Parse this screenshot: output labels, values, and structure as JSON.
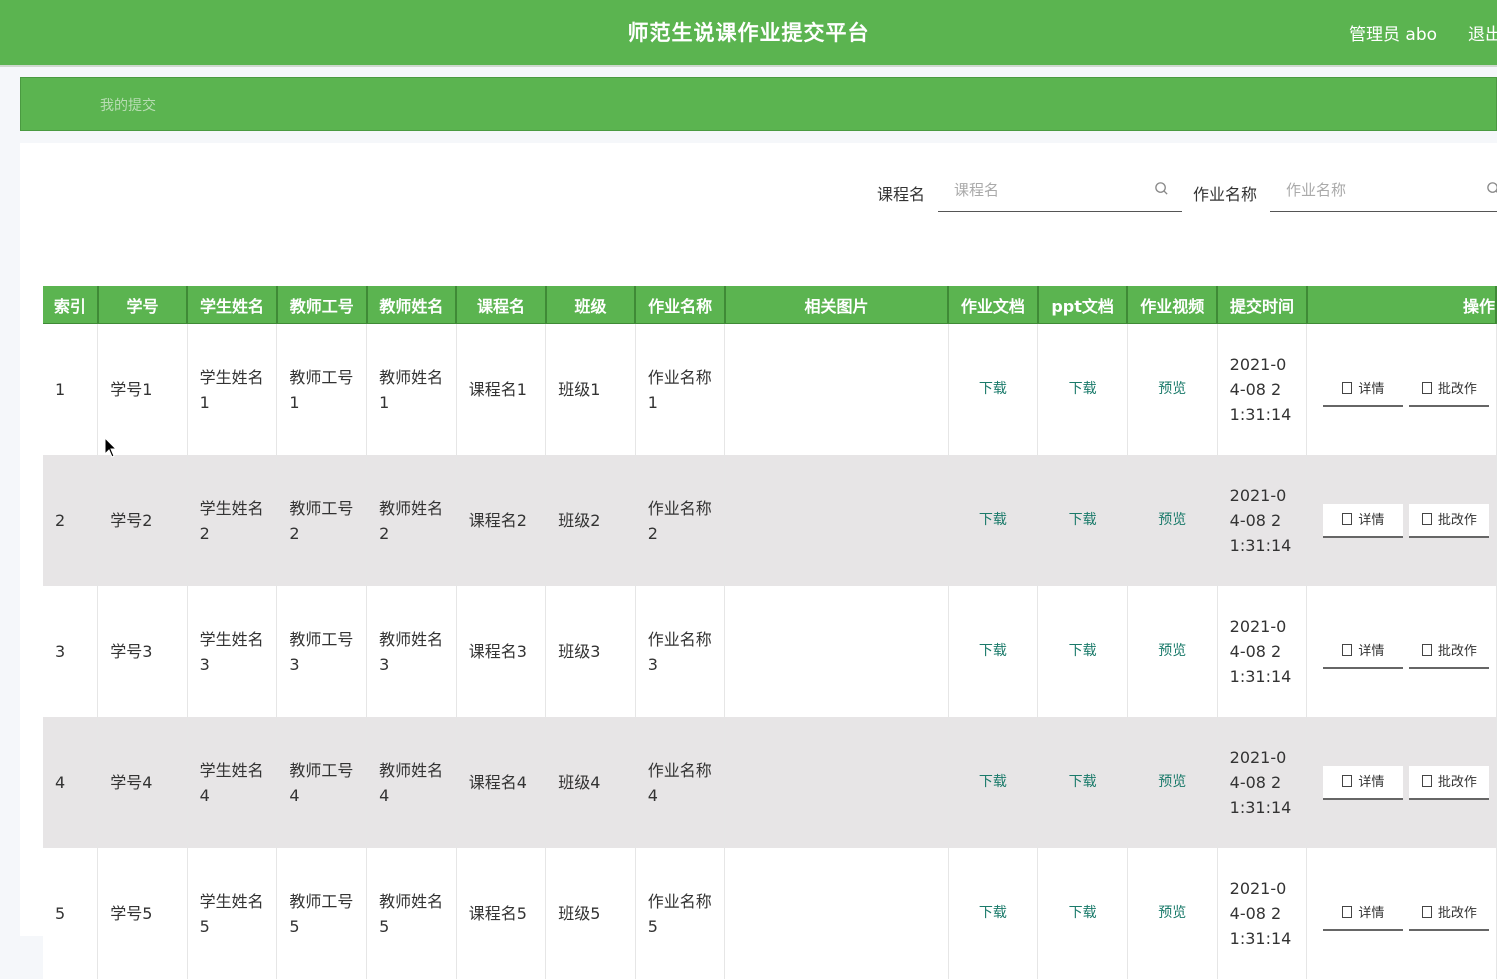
{
  "header": {
    "title": "师范生说课作业提交平台",
    "user": "管理员 abo",
    "logout": "退出"
  },
  "nav": {
    "items": [
      "我的提交"
    ]
  },
  "search": {
    "course_label": "课程名",
    "course_placeholder": "课程名",
    "homework_label": "作业名称",
    "homework_placeholder": "作业名称"
  },
  "table": {
    "columns": [
      "索引",
      "学号",
      "学生姓名",
      "教师工号",
      "教师姓名",
      "课程名",
      "班级",
      "作业名称",
      "相关图片",
      "作业文档",
      "ppt文档",
      "作业视频",
      "提交时间",
      "操作"
    ],
    "rows": [
      {
        "index": "1",
        "student_no": "学号1",
        "student_name": "学生姓名1",
        "teacher_no": "教师工号1",
        "teacher_name": "教师姓名1",
        "course": "课程名1",
        "class": "班级1",
        "homework": "作业名称1",
        "doc": "下载",
        "ppt": "下载",
        "video": "预览",
        "time": "2021-04-08 21:31:14",
        "detail": "详情",
        "grade": "批改作"
      },
      {
        "index": "2",
        "student_no": "学号2",
        "student_name": "学生姓名2",
        "teacher_no": "教师工号2",
        "teacher_name": "教师姓名2",
        "course": "课程名2",
        "class": "班级2",
        "homework": "作业名称2",
        "doc": "下载",
        "ppt": "下载",
        "video": "预览",
        "time": "2021-04-08 21:31:14",
        "detail": "详情",
        "grade": "批改作"
      },
      {
        "index": "3",
        "student_no": "学号3",
        "student_name": "学生姓名3",
        "teacher_no": "教师工号3",
        "teacher_name": "教师姓名3",
        "course": "课程名3",
        "class": "班级3",
        "homework": "作业名称3",
        "doc": "下载",
        "ppt": "下载",
        "video": "预览",
        "time": "2021-04-08 21:31:14",
        "detail": "详情",
        "grade": "批改作"
      },
      {
        "index": "4",
        "student_no": "学号4",
        "student_name": "学生姓名4",
        "teacher_no": "教师工号4",
        "teacher_name": "教师姓名4",
        "course": "课程名4",
        "class": "班级4",
        "homework": "作业名称4",
        "doc": "下载",
        "ppt": "下载",
        "video": "预览",
        "time": "2021-04-08 21:31:14",
        "detail": "详情",
        "grade": "批改作"
      },
      {
        "index": "5",
        "student_no": "学号5",
        "student_name": "学生姓名5",
        "teacher_no": "教师工号5",
        "teacher_name": "教师姓名5",
        "course": "课程名5",
        "class": "班级5",
        "homework": "作业名称5",
        "doc": "下载",
        "ppt": "下载",
        "video": "预览",
        "time": "2021-04-08 21:31:14",
        "detail": "详情",
        "grade": "批改作"
      }
    ]
  },
  "colors": {
    "primary": "#5bb450",
    "link": "#1a7a6a",
    "row_alt": "#e7e5e6"
  }
}
